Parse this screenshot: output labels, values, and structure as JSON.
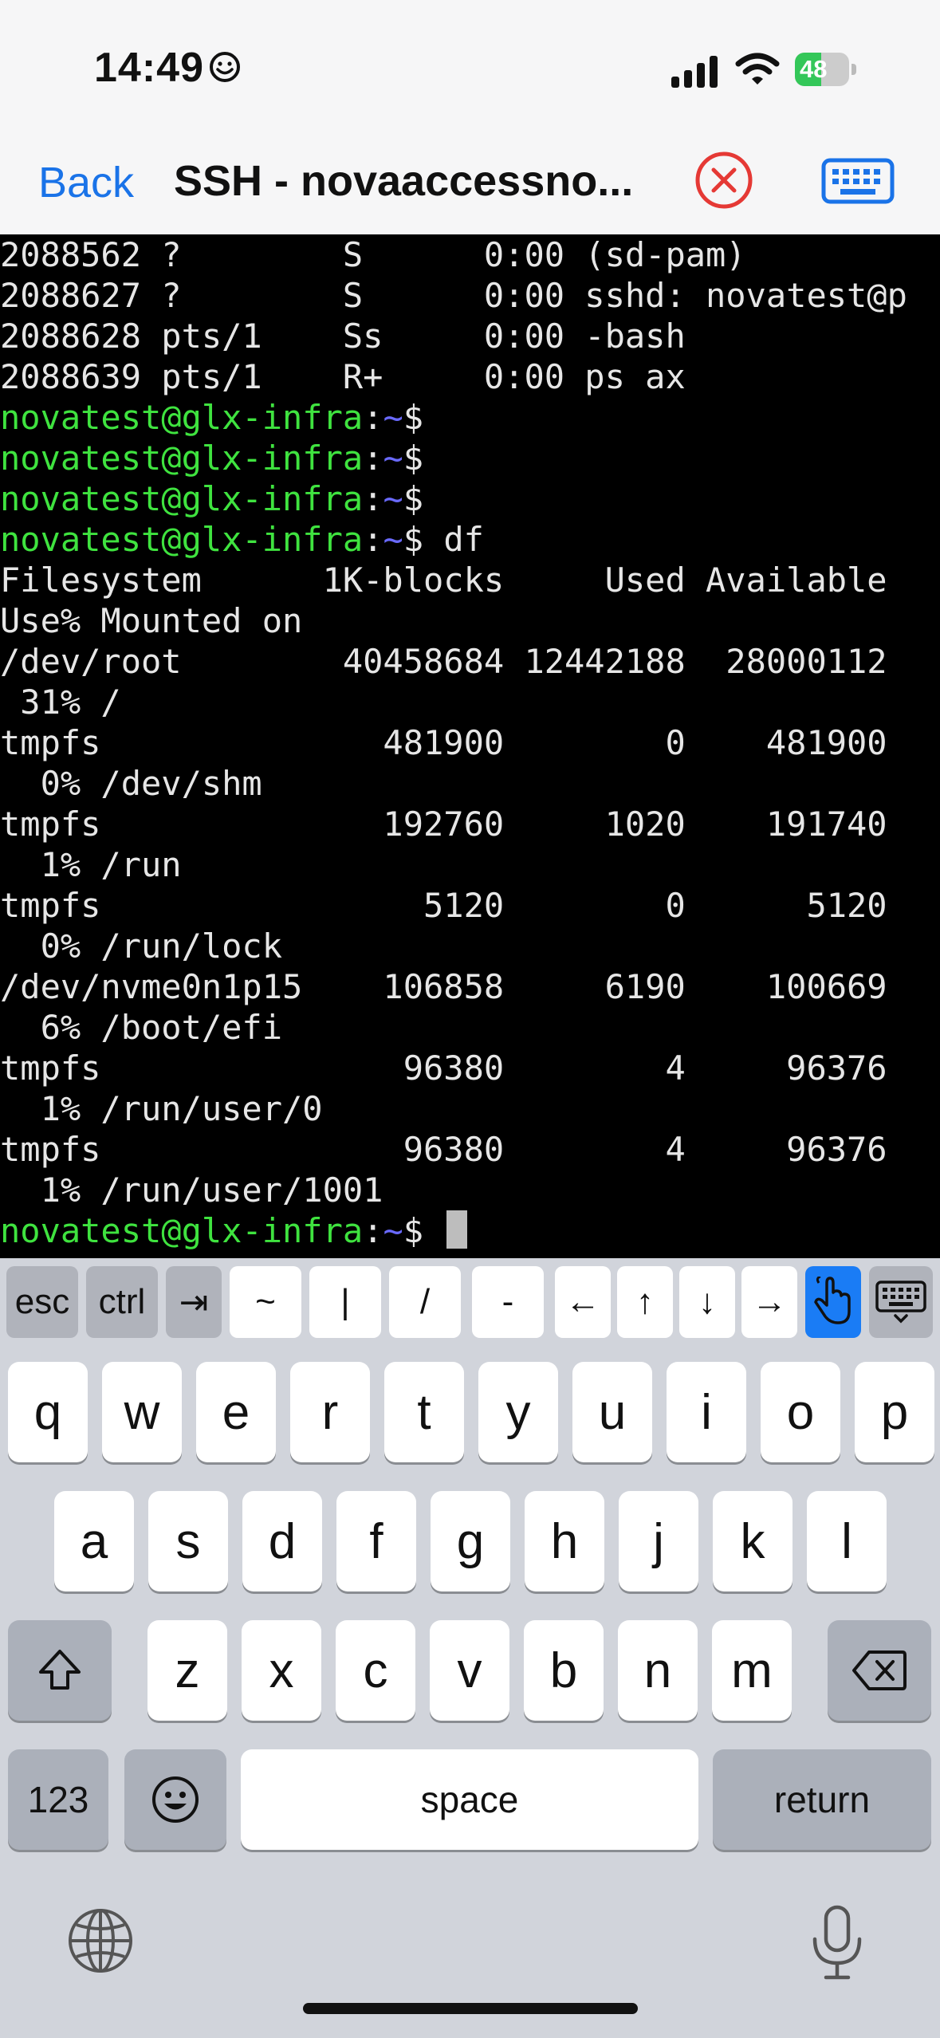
{
  "status": {
    "time": "14:49",
    "battery": "48",
    "battery_level": 0.48
  },
  "nav": {
    "back_label": "Back",
    "title": "SSH - novaaccessno..."
  },
  "colors": {
    "accent": "#1a73e8",
    "prompt_user": "#3fe33f",
    "prompt_path": "#6a6aff",
    "close": "#e53935"
  },
  "terminal": {
    "lines": [
      {
        "text": "2088562 ?        S      0:00 (sd-pam)"
      },
      {
        "text": "2088627 ?        S      0:00 sshd: novatest@p"
      },
      {
        "text": "2088628 pts/1    Ss     0:00 -bash"
      },
      {
        "text": "2088639 pts/1    R+     0:00 ps ax"
      },
      {
        "user": "novatest@glx-infra",
        "sep": ":",
        "path": "~",
        "dollar": "$",
        "cmd": ""
      },
      {
        "user": "novatest@glx-infra",
        "sep": ":",
        "path": "~",
        "dollar": "$",
        "cmd": ""
      },
      {
        "user": "novatest@glx-infra",
        "sep": ":",
        "path": "~",
        "dollar": "$",
        "cmd": ""
      },
      {
        "user": "novatest@glx-infra",
        "sep": ":",
        "path": "~",
        "dollar": "$",
        "cmd": " df"
      },
      {
        "text": "Filesystem      1K-blocks     Used Available"
      },
      {
        "text": "Use% Mounted on"
      },
      {
        "text": "/dev/root        40458684 12442188  28000112"
      },
      {
        "text": " 31% /"
      },
      {
        "text": "tmpfs              481900        0    481900"
      },
      {
        "text": "  0% /dev/shm"
      },
      {
        "text": "tmpfs              192760     1020    191740"
      },
      {
        "text": "  1% /run"
      },
      {
        "text": "tmpfs                5120        0      5120"
      },
      {
        "text": "  0% /run/lock"
      },
      {
        "text": "/dev/nvme0n1p15    106858     6190    100669"
      },
      {
        "text": "  6% /boot/efi"
      },
      {
        "text": "tmpfs               96380        4     96376"
      },
      {
        "text": "  1% /run/user/0"
      },
      {
        "text": "tmpfs               96380        4     96376"
      },
      {
        "text": "  1% /run/user/1001"
      },
      {
        "user": "novatest@glx-infra",
        "sep": ":",
        "path": "~",
        "dollar": "$",
        "cmd": " ",
        "cursor": true
      }
    ]
  },
  "accessory": {
    "esc": "esc",
    "ctrl": "ctrl",
    "tab": "⇥",
    "tilde": "~",
    "pipe": "|",
    "slash": "/",
    "dash": "-",
    "left": "←",
    "up": "↑",
    "down": "↓",
    "right": "→"
  },
  "keyboard": {
    "row1": [
      "q",
      "w",
      "e",
      "r",
      "t",
      "y",
      "u",
      "i",
      "o",
      "p"
    ],
    "row2": [
      "a",
      "s",
      "d",
      "f",
      "g",
      "h",
      "j",
      "k",
      "l"
    ],
    "row3": [
      "z",
      "x",
      "c",
      "v",
      "b",
      "n",
      "m"
    ],
    "shift": "⇧",
    "numbers": "123",
    "emoji": "☺",
    "space": "space",
    "return": "return"
  }
}
